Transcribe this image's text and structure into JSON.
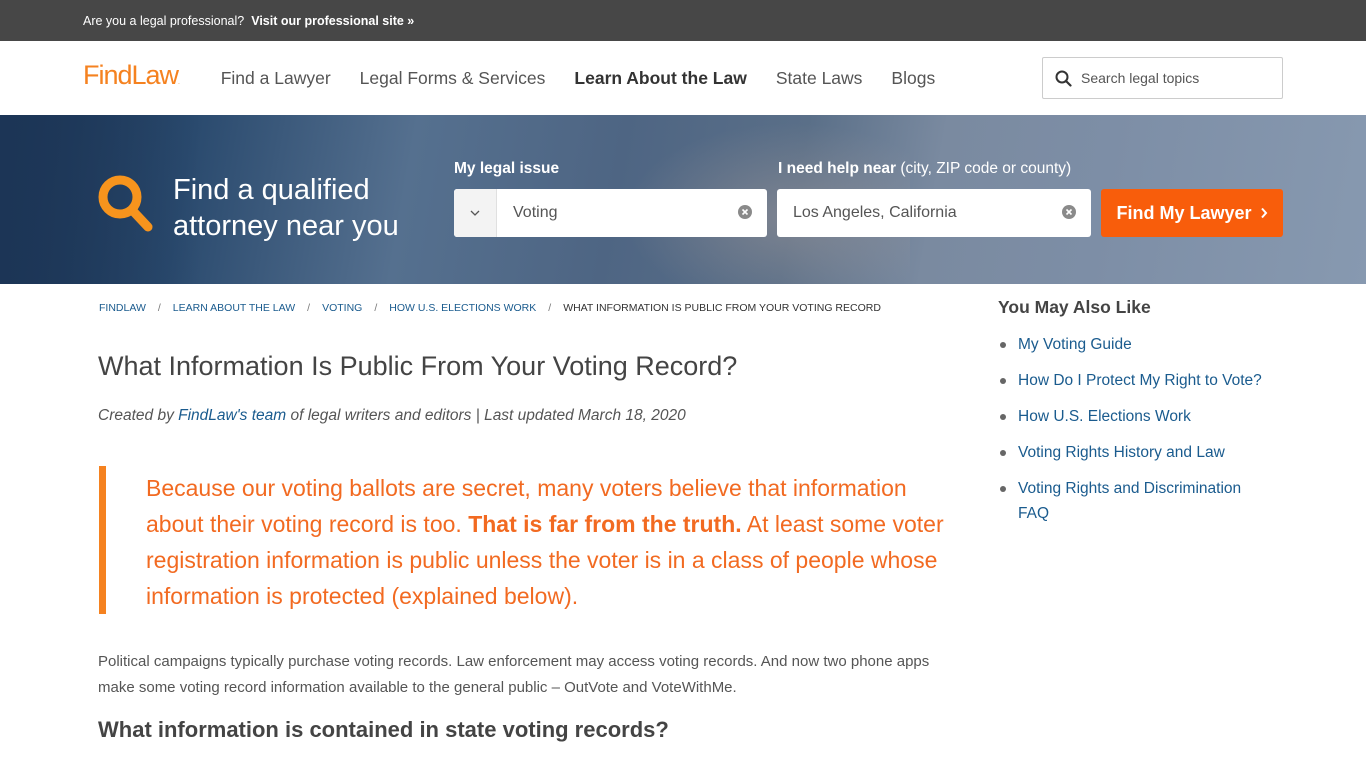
{
  "topbar": {
    "question": "Are you a legal professional?",
    "link": "Visit our professional site »"
  },
  "header": {
    "logo": "FindLaw",
    "nav": [
      {
        "label": "Find a Lawyer",
        "active": false
      },
      {
        "label": "Legal Forms & Services",
        "active": false
      },
      {
        "label": "Learn About the Law",
        "active": true
      },
      {
        "label": "State Laws",
        "active": false
      },
      {
        "label": "Blogs",
        "active": false
      }
    ],
    "search_placeholder": "Search legal topics"
  },
  "hero": {
    "title_line1": "Find a qualified",
    "title_line2": "attorney near you",
    "issue_label": "My legal issue",
    "issue_value": "Voting",
    "location_label_bold": "I need help near",
    "location_label_rest": " (city, ZIP code or county)",
    "location_value": "Los Angeles, California",
    "button_label": "Find My Lawyer",
    "accent_color": "#f85d0b"
  },
  "breadcrumb": [
    {
      "label": "FINDLAW",
      "link": true
    },
    {
      "label": "LEARN ABOUT THE LAW",
      "link": true
    },
    {
      "label": "VOTING",
      "link": true
    },
    {
      "label": "HOW U.S. ELECTIONS WORK",
      "link": true
    },
    {
      "label": "WHAT INFORMATION IS PUBLIC FROM YOUR VOTING RECORD",
      "link": false
    }
  ],
  "article": {
    "title": "What Information Is Public From Your Voting Record?",
    "byline_prefix": "Created by ",
    "byline_link": "FindLaw's team",
    "byline_suffix": " of legal writers and editors | Last updated March 18, 2020",
    "pullquote_part1": "Because our voting ballots are secret, many voters believe that information about their voting record is too. ",
    "pullquote_bold": "That is far from the truth.",
    "pullquote_part2": " At least some voter registration information is public unless the voter is in a class of people whose information is protected (explained below).",
    "paragraph1": "Political campaigns typically purchase voting records. Law enforcement may access voting records. And now two phone apps make some voting record information available to the general public – OutVote and VoteWithMe.",
    "heading2": "What information is contained in state voting records?"
  },
  "sidebar": {
    "title": "You May Also Like",
    "links": [
      "My Voting Guide",
      "How Do I Protect My Right to Vote?",
      "How U.S. Elections Work",
      "Voting Rights History and Law",
      "Voting Rights and Discrimination FAQ"
    ]
  }
}
